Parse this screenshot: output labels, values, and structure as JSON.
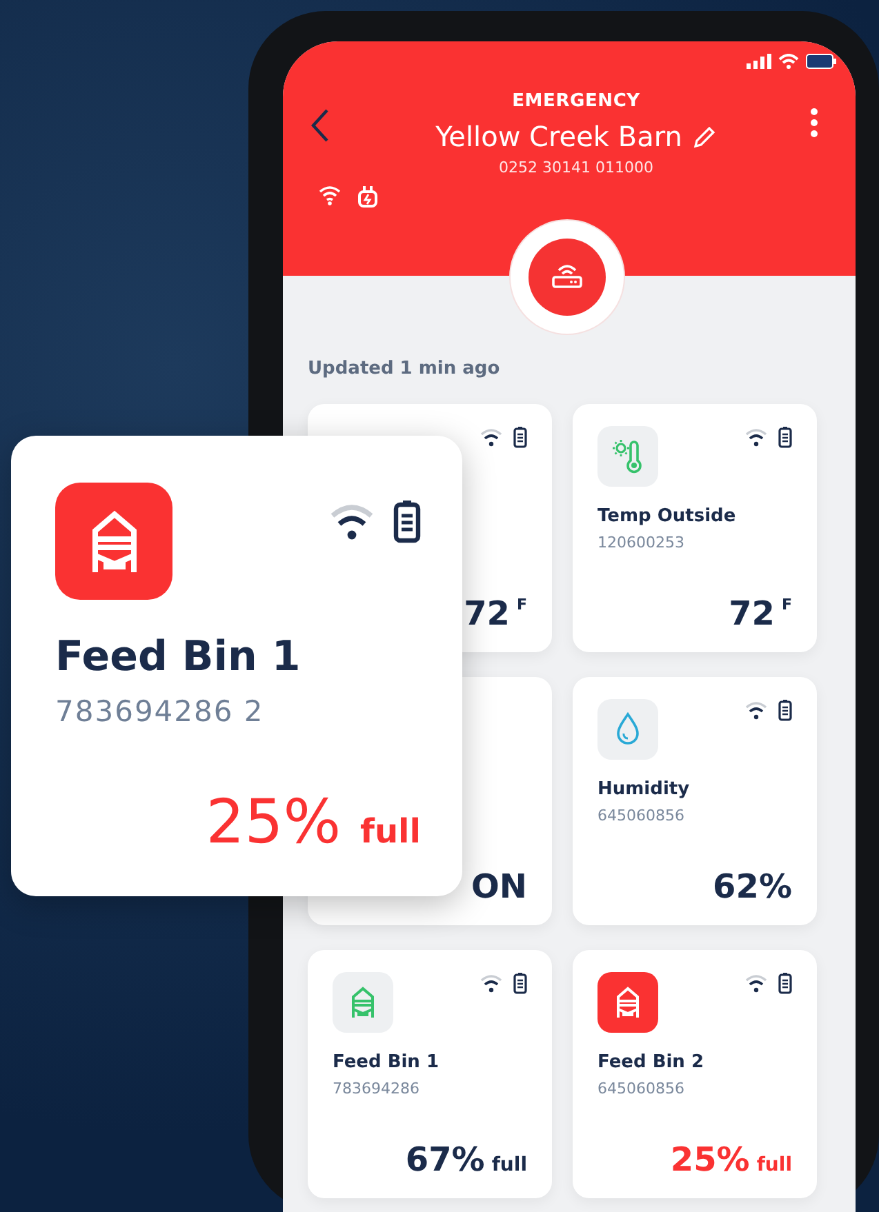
{
  "header": {
    "status": "EMERGENCY",
    "title": "Yellow Creek Barn",
    "serial": "0252 30141 011000"
  },
  "updated": "Updated 1 min ago",
  "cards": [
    {
      "kind": "covered",
      "status_icons": true,
      "value": "72",
      "unit": "F",
      "alert": false
    },
    {
      "kind": "covered",
      "status_icons": false,
      "value": "ON",
      "alert": false
    },
    {
      "kind": "bin",
      "status_icons": true,
      "name": "Feed Bin 1",
      "serial": "783694286",
      "value": "67%",
      "unit": "full",
      "alert": false
    },
    {
      "kind": "temperature",
      "status_icons": true,
      "name": "Temp Outside",
      "serial": "120600253",
      "value": "72",
      "unit": "F",
      "alert": false
    },
    {
      "kind": "humidity",
      "status_icons": true,
      "name": "Humidity",
      "serial": "645060856",
      "value": "62%",
      "alert": false
    },
    {
      "kind": "bin",
      "status_icons": true,
      "name": "Feed Bin 2",
      "serial": "645060856",
      "value": "25%",
      "unit": "full",
      "alert": true
    }
  ],
  "featured": {
    "kind": "bin",
    "name": "Feed Bin 1",
    "serial": "783694286 2",
    "value": "25%",
    "unit": "full",
    "alert": true
  }
}
